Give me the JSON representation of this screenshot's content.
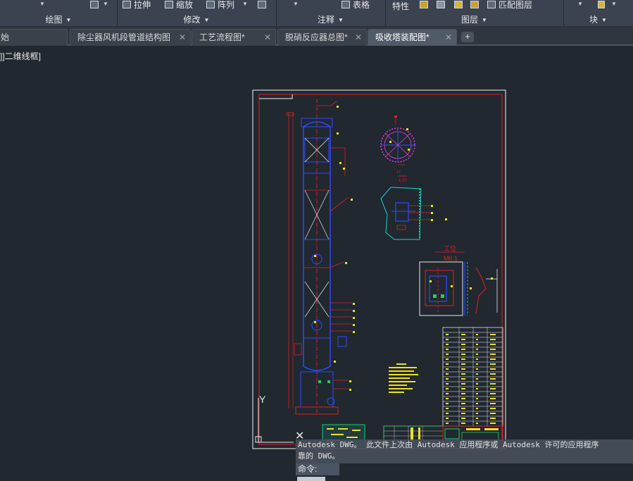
{
  "ribbon": {
    "panels": [
      {
        "title": "绘图"
      },
      {
        "title": "修改"
      },
      {
        "title": "注释"
      },
      {
        "title": "图层"
      },
      {
        "title": "块"
      }
    ],
    "tools": {
      "stretch": "拉伸",
      "scale": "缩放",
      "array": "阵列",
      "table": "表格",
      "properties": "特性",
      "match_layer": "匹配图层"
    }
  },
  "tabs": {
    "items": [
      {
        "label": "始"
      },
      {
        "label": "除尘器风机段管道结构图",
        "close": "✕"
      },
      {
        "label": "工艺流程图*",
        "close": "✕"
      },
      {
        "label": "脱硝反应器总图*",
        "close": "✕"
      },
      {
        "label": "吸收塔装配图*",
        "close": "✕"
      }
    ],
    "add": "+"
  },
  "viewport": {
    "label": "]]二维线框]"
  },
  "drawing": {
    "ucs_y": "Y",
    "ucs_x": "✕",
    "section_label": "I-I",
    "section_scale": "1:20",
    "detail_label": "工位",
    "detail_scale": "M6:1"
  },
  "command": {
    "output_line1": "Autodesk DWG。  此文件上次由 Autodesk 应用程序或 Autodesk 许可的应用程序",
    "output_line2": "靠的 DWG。",
    "prompt": "命令:"
  }
}
